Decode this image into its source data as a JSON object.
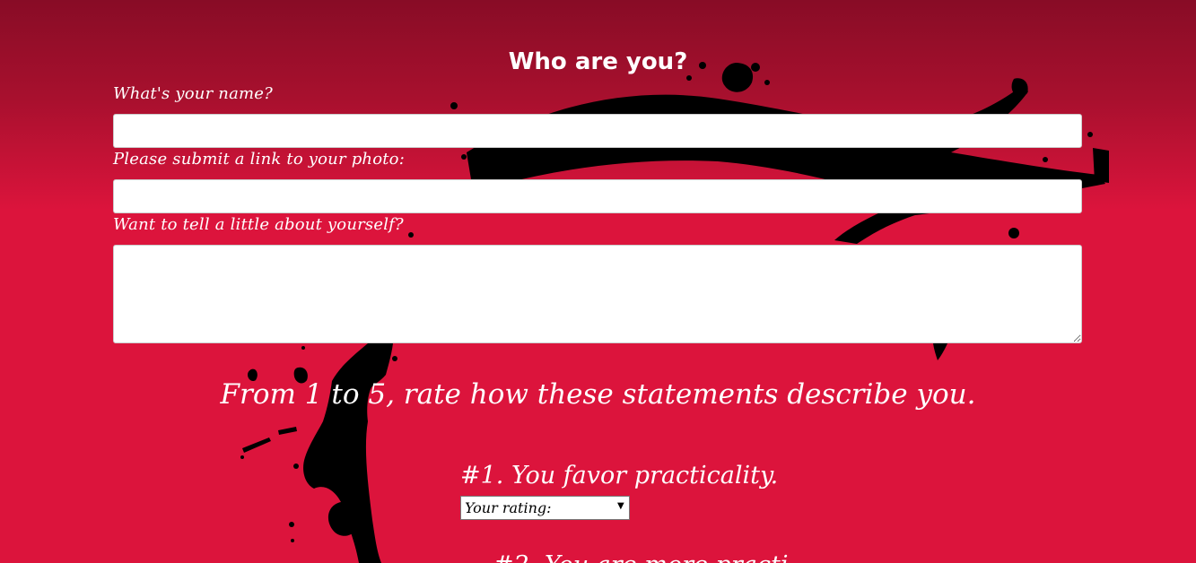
{
  "form": {
    "section_title": "Who are you?",
    "name_label": "What's your name?",
    "name_value": "",
    "photo_label": "Please submit a link to your photo:",
    "photo_value": "",
    "about_label": "Want to tell a little about yourself?",
    "about_value": ""
  },
  "rating": {
    "heading": "From 1 to 5, rate how these statements describe you.",
    "questions": [
      {
        "label": "#1. You favor practicality.",
        "select_value": "Your rating:"
      },
      {
        "label": "#2. You are more practi"
      }
    ]
  },
  "colors": {
    "background_top": "#880c26",
    "background_main": "#dc143c",
    "text": "#ffffff",
    "splatter": "#000000"
  },
  "icons": {
    "select_arrow": "chevron-down-icon"
  }
}
